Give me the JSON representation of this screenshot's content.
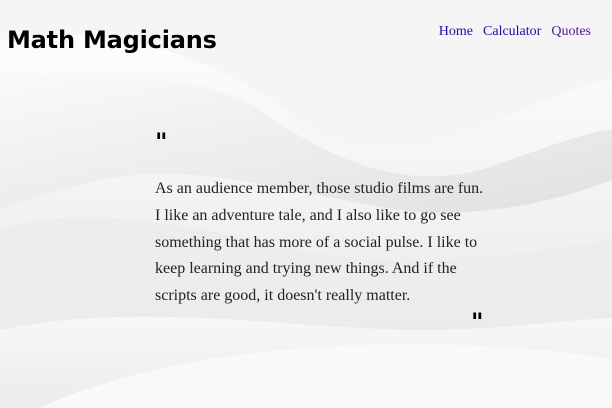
{
  "app": {
    "title": "Math Magicians"
  },
  "nav": {
    "items": [
      {
        "label": "Home",
        "visited": false
      },
      {
        "label": "Calculator",
        "visited": false
      },
      {
        "label": "Quotes",
        "visited": true
      }
    ]
  },
  "quote": {
    "open_mark": "\"",
    "close_mark": "\"",
    "text": "As an audience member, those studio films are fun. I like an adventure tale, and I also like to go see something that has more of a social pulse. I like to keep learning and trying new things. And if the scripts are good, it doesn't really matter."
  },
  "colors": {
    "link": "#1a0dab",
    "link_visited": "#551a8b",
    "background": "#f2f2f2"
  }
}
